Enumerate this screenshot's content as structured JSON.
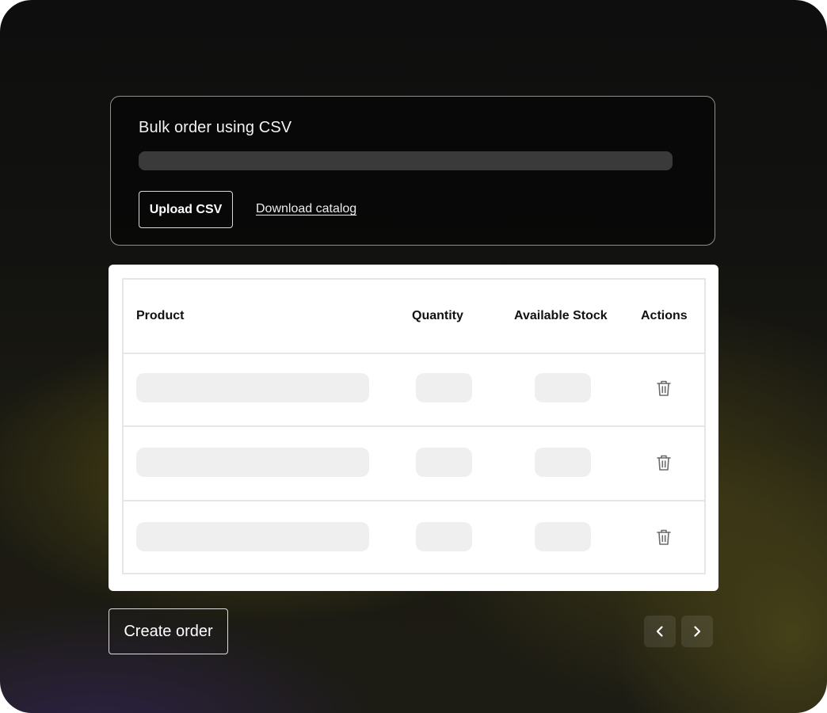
{
  "upload": {
    "title": "Bulk order using CSV",
    "progress_percent": 0,
    "upload_button": "Upload CSV",
    "download_link": "Download catalog"
  },
  "table": {
    "headers": [
      "Product",
      "Quantity",
      "Available Stock",
      "Actions"
    ],
    "rows": [
      {
        "product": "",
        "quantity": "",
        "stock": "",
        "action_icon": "trash-icon"
      },
      {
        "product": "",
        "quantity": "",
        "stock": "",
        "action_icon": "trash-icon"
      },
      {
        "product": "",
        "quantity": "",
        "stock": "",
        "action_icon": "trash-icon"
      }
    ]
  },
  "footer": {
    "create_button": "Create order",
    "prev_icon": "chevron-left-icon",
    "next_icon": "chevron-right-icon"
  },
  "colors": {
    "frame_background": "#121210",
    "card_border": "#ffffff",
    "skeleton": "#efefef",
    "table_border": "#e6e6e6",
    "icon_gray": "#6b6b6b"
  }
}
